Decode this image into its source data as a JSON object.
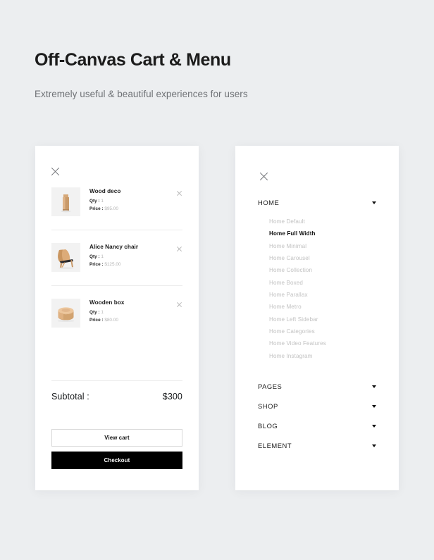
{
  "header": {
    "title": "Off-Canvas Cart & Menu",
    "subtitle": "Extremely useful & beautiful experiences for users"
  },
  "colors": {
    "background": "#eceef0",
    "panel": "#ffffff",
    "text_dark": "#1a1a1a",
    "text_muted": "#c2c2c2",
    "checkout_bg": "#000000",
    "divider": "#ececec",
    "thumb_bg": "#f2f2f2"
  },
  "cart_panel": {
    "close_icon": "close-icon",
    "items": [
      {
        "name": "Wood deco",
        "qty_label": "Qty :",
        "qty_value": "1",
        "price_label": "Price :",
        "price_value": "$95.00",
        "thumb": "wood-deco-thumb",
        "remove_icon": "remove-icon"
      },
      {
        "name": "Alice Nancy chair",
        "qty_label": "Qty :",
        "qty_value": "1",
        "price_label": "Price :",
        "price_value": "$125.00",
        "thumb": "alice-nancy-chair-thumb",
        "remove_icon": "remove-icon"
      },
      {
        "name": "Wooden box",
        "qty_label": "Qty :",
        "qty_value": "1",
        "price_label": "Price :",
        "price_value": "$80.00",
        "thumb": "wooden-box-thumb",
        "remove_icon": "remove-icon"
      }
    ],
    "subtotal_label": "Subtotal :",
    "subtotal_value": "$300",
    "view_cart_label": "View cart",
    "checkout_label": "Checkout"
  },
  "menu_panel": {
    "close_icon": "close-icon",
    "home": {
      "label": "HOME",
      "caret_icon": "chevron-down-icon",
      "expanded": true,
      "items": [
        {
          "label": "Home Default",
          "active": false
        },
        {
          "label": "Home Full Width",
          "active": true
        },
        {
          "label": "Home Minimal",
          "active": false
        },
        {
          "label": "Home Carousel",
          "active": false
        },
        {
          "label": "Home Collection",
          "active": false
        },
        {
          "label": "Home Boxed",
          "active": false
        },
        {
          "label": "Home Parallax",
          "active": false
        },
        {
          "label": "Home Metro",
          "active": false
        },
        {
          "label": "Home Left Sidebar",
          "active": false
        },
        {
          "label": "Home Categories",
          "active": false
        },
        {
          "label": "Home Video Features",
          "active": false
        },
        {
          "label": "Home Instagram",
          "active": false
        }
      ]
    },
    "sections": [
      {
        "label": "PAGES",
        "caret_icon": "chevron-down-icon"
      },
      {
        "label": "SHOP",
        "caret_icon": "chevron-down-icon"
      },
      {
        "label": "BLOG",
        "caret_icon": "chevron-down-icon"
      },
      {
        "label": "ELEMENT",
        "caret_icon": "chevron-down-icon"
      }
    ]
  }
}
